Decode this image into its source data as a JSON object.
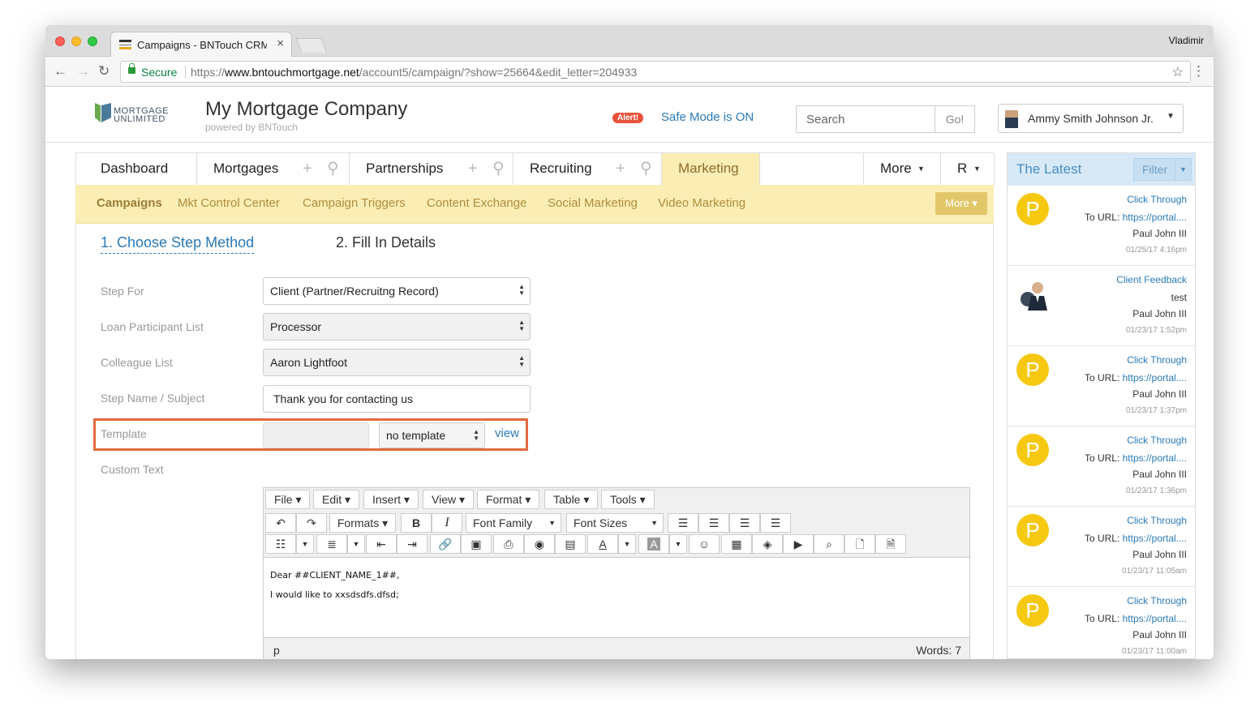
{
  "browser": {
    "tab_title": "Campaigns - BNTouch CRM (d",
    "profile_name": "Vladimir",
    "secure_label": "Secure",
    "url_scheme": "https://",
    "url_host": "www.bntouchmortgage.net",
    "url_path": "/account5/campaign/?show=25664&edit_letter=204933"
  },
  "header": {
    "logo_line1": "MORTGAGE",
    "logo_line2": "UNLIMITED",
    "company": "My Mortgage Company",
    "powered_by": "powered by BNTouch",
    "alert_badge": "Alert!",
    "safe_mode": "Safe Mode is ON",
    "search_placeholder": "Search",
    "go_label": "Go!",
    "user_name": "Ammy Smith Johnson Jr."
  },
  "main_tabs": [
    {
      "label": "Dashboard"
    },
    {
      "label": "Mortgages"
    },
    {
      "label": "Partnerships"
    },
    {
      "label": "Recruiting"
    },
    {
      "label": "Marketing"
    },
    {
      "label": "More"
    },
    {
      "label": "R"
    }
  ],
  "sub_nav": {
    "items": [
      "Campaigns",
      "Mkt Control Center",
      "Campaign Triggers",
      "Content Exchange",
      "Social Marketing",
      "Video Marketing"
    ],
    "more_label": "More"
  },
  "steps": {
    "step1": "1. Choose Step Method",
    "step2": "2. Fill In Details"
  },
  "form": {
    "step_for_label": "Step For",
    "step_for_value": "Client (Partner/Recruitng Record)",
    "loan_participant_label": "Loan Participant List",
    "loan_participant_value": "Processor",
    "colleague_label": "Colleague List",
    "colleague_value": "Aaron Lightfoot",
    "step_name_label": "Step Name / Subject",
    "step_name_value": "Thank you for contacting us",
    "template_label": "Template",
    "template_value": "no template",
    "template_view": "view",
    "custom_text_label": "Custom Text"
  },
  "editor": {
    "menu": [
      "File",
      "Edit",
      "Insert",
      "View",
      "Format",
      "Table",
      "Tools"
    ],
    "formats": "Formats",
    "font_family": "Font Family",
    "font_sizes": "Font Sizes",
    "line1": "Dear ##CLIENT_NAME_1##,",
    "line2": "I would like to xxsdsdfs.dfsd;",
    "path": "p",
    "word_count": "Words: 7"
  },
  "sidebar": {
    "title": "The Latest",
    "filter_label": "Filter",
    "items": [
      {
        "kind": "letter",
        "initial": "P",
        "action": "Click Through",
        "prefix": "To URL: ",
        "link": "https://portal....",
        "name": "Paul John III",
        "date": "01/25/17 4:16pm"
      },
      {
        "kind": "photo",
        "initial": "",
        "action": "Client Feedback",
        "prefix": "test",
        "link": "",
        "name": "Paul John III",
        "date": "01/23/17 1:52pm"
      },
      {
        "kind": "letter",
        "initial": "P",
        "action": "Click Through",
        "prefix": "To URL: ",
        "link": "https://portal....",
        "name": "Paul John III",
        "date": "01/23/17 1:37pm"
      },
      {
        "kind": "letter",
        "initial": "P",
        "action": "Click Through",
        "prefix": "To URL: ",
        "link": "https://portal....",
        "name": "Paul John III",
        "date": "01/23/17 1:36pm"
      },
      {
        "kind": "letter",
        "initial": "P",
        "action": "Click Through",
        "prefix": "To URL: ",
        "link": "https://portal....",
        "name": "Paul John III",
        "date": "01/23/17 11:05am"
      },
      {
        "kind": "letter",
        "initial": "P",
        "action": "Click Through",
        "prefix": "To URL: ",
        "link": "https://portal....",
        "name": "Paul John III",
        "date": "01/23/17 11:00am"
      }
    ]
  }
}
